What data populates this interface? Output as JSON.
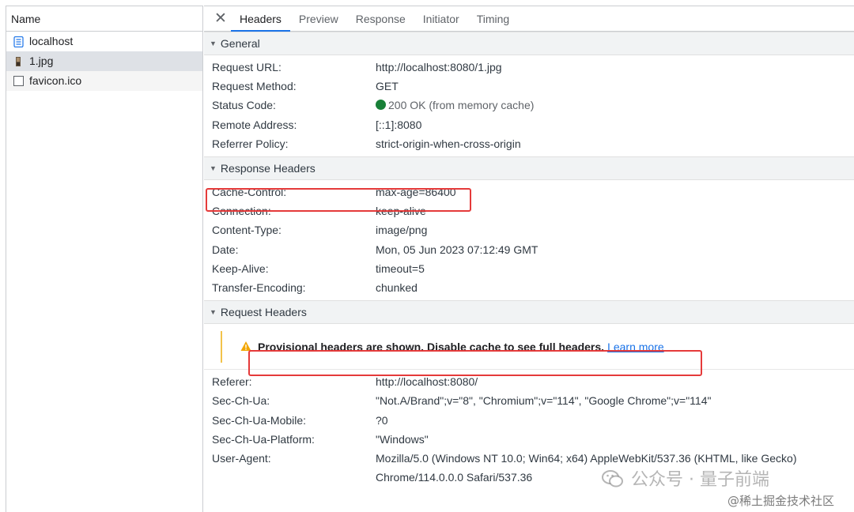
{
  "left": {
    "header": "Name",
    "requests": [
      {
        "name": "localhost",
        "icon": "document-icon"
      },
      {
        "name": "1.jpg",
        "icon": "image-icon"
      },
      {
        "name": "favicon.ico",
        "icon": "blank-file-icon"
      }
    ]
  },
  "tabs": {
    "close": "✕",
    "items": [
      "Headers",
      "Preview",
      "Response",
      "Initiator",
      "Timing"
    ],
    "active": "Headers"
  },
  "general": {
    "title": "General",
    "rows": [
      {
        "key": "Request URL:",
        "value": "http://localhost:8080/1.jpg"
      },
      {
        "key": "Request Method:",
        "value": "GET"
      },
      {
        "key": "Status Code:",
        "value": "200 OK (from memory cache)"
      },
      {
        "key": "Remote Address:",
        "value": "[::1]:8080"
      },
      {
        "key": "Referrer Policy:",
        "value": "strict-origin-when-cross-origin"
      }
    ]
  },
  "response_headers": {
    "title": "Response Headers",
    "rows": [
      {
        "key": "Cache-Control:",
        "value": "max-age=86400"
      },
      {
        "key": "Connection:",
        "value": "keep-alive"
      },
      {
        "key": "Content-Type:",
        "value": "image/png"
      },
      {
        "key": "Date:",
        "value": "Mon, 05 Jun 2023 07:12:49 GMT"
      },
      {
        "key": "Keep-Alive:",
        "value": "timeout=5"
      },
      {
        "key": "Transfer-Encoding:",
        "value": "chunked"
      }
    ]
  },
  "request_headers": {
    "title": "Request Headers",
    "warning": "Provisional headers are shown. Disable cache to see full headers.",
    "learn_more": "Learn more",
    "rows": [
      {
        "key": "Referer:",
        "value": "http://localhost:8080/"
      },
      {
        "key": "Sec-Ch-Ua:",
        "value": "\"Not.A/Brand\";v=\"8\", \"Chromium\";v=\"114\", \"Google Chrome\";v=\"114\""
      },
      {
        "key": "Sec-Ch-Ua-Mobile:",
        "value": "?0"
      },
      {
        "key": "Sec-Ch-Ua-Platform:",
        "value": "\"Windows\""
      },
      {
        "key": "User-Agent:",
        "value": "Mozilla/5.0 (Windows NT 10.0; Win64; x64) AppleWebKit/537.36 (KHTML, like Gecko)"
      },
      {
        "key": "",
        "value": "Chrome/114.0.0.0 Safari/537.36"
      }
    ]
  },
  "colors": {
    "accent": "#1a73e8",
    "status_ok": "#188038",
    "highlight_box": "#e53a3a",
    "warning": "#f2c34b"
  },
  "watermark": {
    "line1": "公众号 · 量子前端",
    "line2": "@稀土掘金技术社区"
  }
}
